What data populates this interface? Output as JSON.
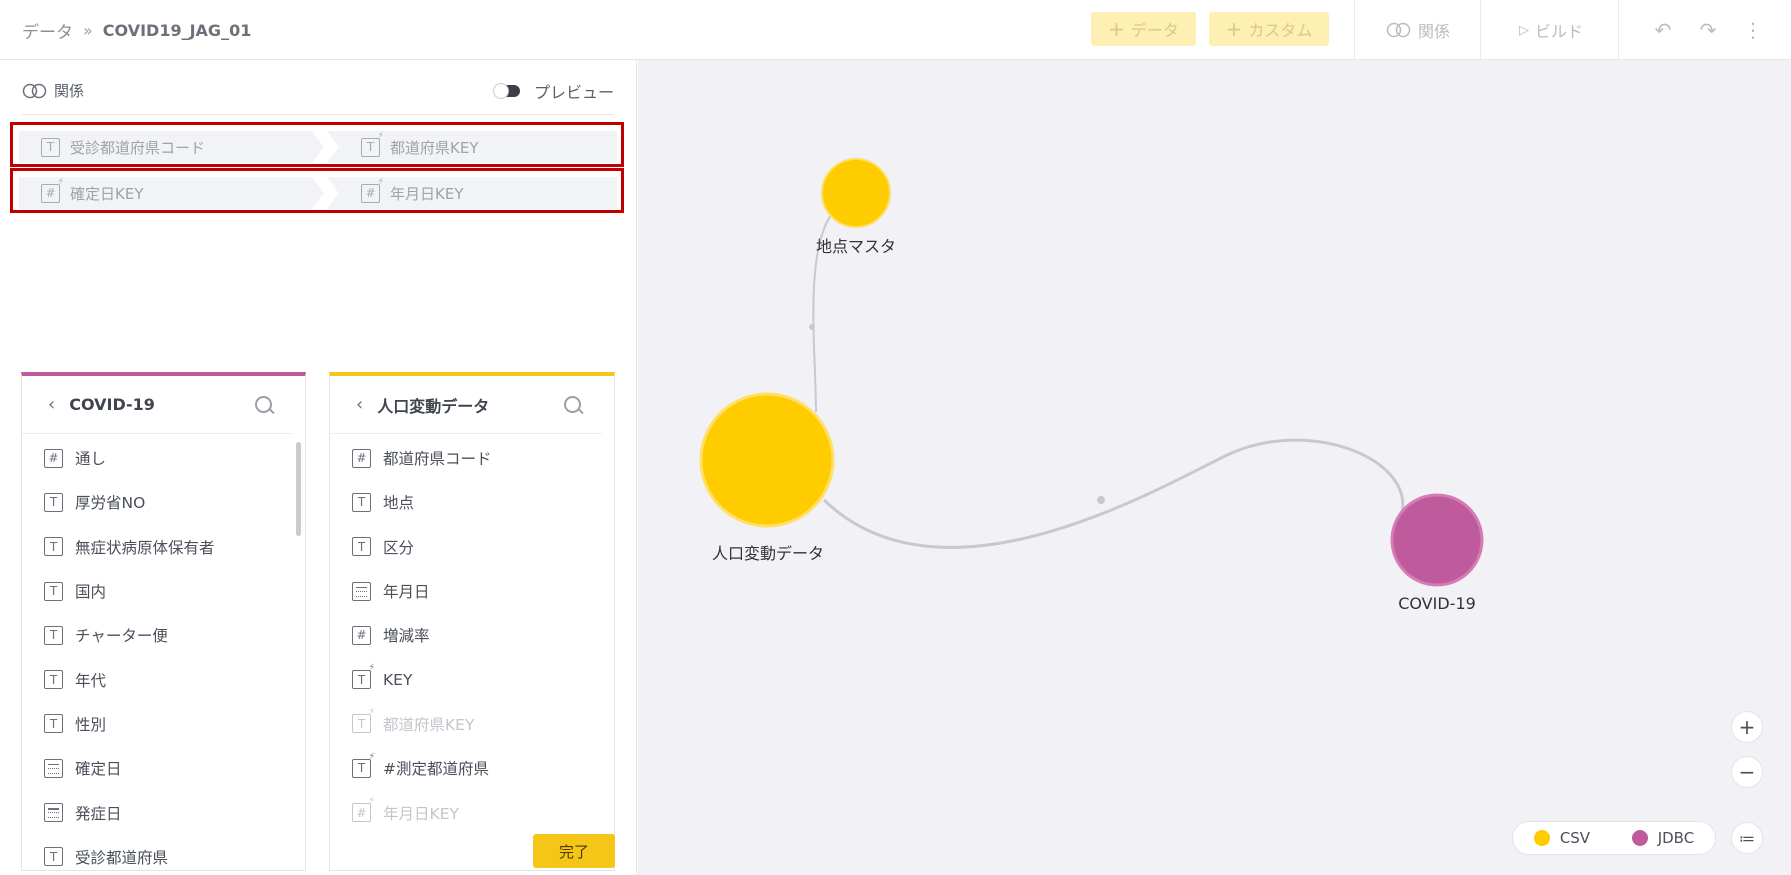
{
  "header": {
    "breadcrumb_root": "データ",
    "breadcrumb_sep": "»",
    "breadcrumb_current": "COVID19_JAG_01",
    "add_data_label": "データ",
    "add_custom_label": "カスタム",
    "relation_label": "関係",
    "build_label": "ビルド"
  },
  "left_panel": {
    "relation_title": "関係",
    "preview_label": "プレビュー",
    "pairs": [
      {
        "left": "受診都道府県コード",
        "right": "都道府県KEY"
      },
      {
        "left": "確定日KEY",
        "right": "年月日KEY"
      }
    ],
    "done_label": "完了"
  },
  "tables": [
    {
      "name": "COVID-19",
      "fields": [
        "通し",
        "厚労省NO",
        "無症状病原体保有者",
        "国内",
        "チャーター便",
        "年代",
        "性別",
        "確定日",
        "発症日",
        "受診都道府県"
      ]
    },
    {
      "name": "人口変動データ",
      "fields": [
        "都道府県コード",
        "地点",
        "区分",
        "年月日",
        "増減率",
        "KEY",
        "都道府県KEY",
        "#測定都道府県",
        "年月日KEY"
      ]
    }
  ],
  "graph": {
    "nodes": [
      {
        "label": "地点マスタ",
        "type": "CSV"
      },
      {
        "label": "人口変動データ",
        "type": "CSV"
      },
      {
        "label": "COVID-19",
        "type": "JDBC"
      }
    ]
  },
  "legend": {
    "csv": "CSV",
    "jdbc": "JDBC"
  },
  "colors": {
    "csv": "#ffcc00",
    "jdbc": "#bf5b9c",
    "selection": "#c00000"
  }
}
